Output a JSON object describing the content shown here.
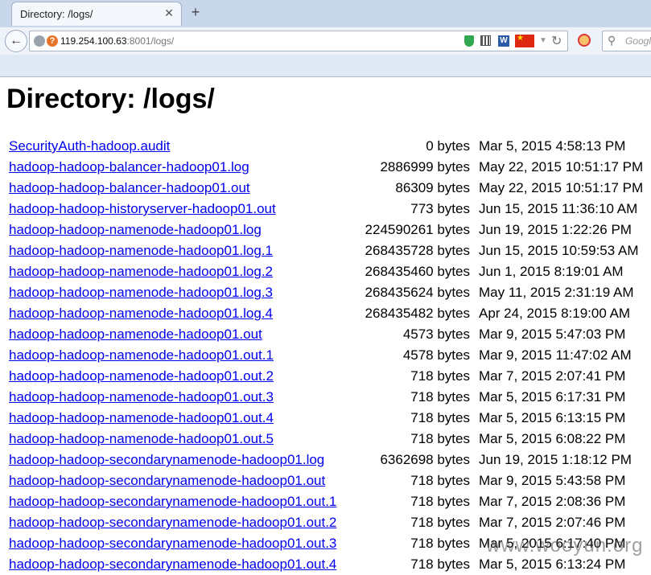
{
  "browser": {
    "tab_title": "Directory: /logs/",
    "tab_close": "✕",
    "new_tab": "+",
    "url_host": "119.254.100.63",
    "url_rest": ":8001/logs/",
    "search_placeholder": "Googl",
    "icons": [
      "back-arrow-icon",
      "globe-icon",
      "warning-icon",
      "shield-icon",
      "qr-code-icon",
      "word-icon",
      "china-flag-icon",
      "dropdown-icon",
      "reload-icon",
      "addon-icon",
      "search-icon"
    ]
  },
  "page": {
    "title": "Directory: /logs/",
    "files": [
      {
        "name": "SecurityAuth-hadoop.audit",
        "size": "0 bytes",
        "date": "Mar 5, 2015 4:58:13 PM"
      },
      {
        "name": "hadoop-hadoop-balancer-hadoop01.log",
        "size": "2886999 bytes",
        "date": "May 22, 2015 10:51:17 PM"
      },
      {
        "name": "hadoop-hadoop-balancer-hadoop01.out",
        "size": "86309 bytes",
        "date": "May 22, 2015 10:51:17 PM"
      },
      {
        "name": "hadoop-hadoop-historyserver-hadoop01.out",
        "size": "773 bytes",
        "date": "Jun 15, 2015 11:36:10 AM"
      },
      {
        "name": "hadoop-hadoop-namenode-hadoop01.log",
        "size": "224590261 bytes",
        "date": "Jun 19, 2015 1:22:26 PM"
      },
      {
        "name": "hadoop-hadoop-namenode-hadoop01.log.1",
        "size": "268435728 bytes",
        "date": "Jun 15, 2015 10:59:53 AM"
      },
      {
        "name": "hadoop-hadoop-namenode-hadoop01.log.2",
        "size": "268435460 bytes",
        "date": "Jun 1, 2015 8:19:01 AM"
      },
      {
        "name": "hadoop-hadoop-namenode-hadoop01.log.3",
        "size": "268435624 bytes",
        "date": "May 11, 2015 2:31:19 AM"
      },
      {
        "name": "hadoop-hadoop-namenode-hadoop01.log.4",
        "size": "268435482 bytes",
        "date": "Apr 24, 2015 8:19:00 AM"
      },
      {
        "name": "hadoop-hadoop-namenode-hadoop01.out",
        "size": "4573 bytes",
        "date": "Mar 9, 2015 5:47:03 PM"
      },
      {
        "name": "hadoop-hadoop-namenode-hadoop01.out.1",
        "size": "4578 bytes",
        "date": "Mar 9, 2015 11:47:02 AM"
      },
      {
        "name": "hadoop-hadoop-namenode-hadoop01.out.2",
        "size": "718 bytes",
        "date": "Mar 7, 2015 2:07:41 PM"
      },
      {
        "name": "hadoop-hadoop-namenode-hadoop01.out.3",
        "size": "718 bytes",
        "date": "Mar 5, 2015 6:17:31 PM"
      },
      {
        "name": "hadoop-hadoop-namenode-hadoop01.out.4",
        "size": "718 bytes",
        "date": "Mar 5, 2015 6:13:15 PM"
      },
      {
        "name": "hadoop-hadoop-namenode-hadoop01.out.5",
        "size": "718 bytes",
        "date": "Mar 5, 2015 6:08:22 PM"
      },
      {
        "name": "hadoop-hadoop-secondarynamenode-hadoop01.log",
        "size": "6362698 bytes",
        "date": "Jun 19, 2015 1:18:12 PM"
      },
      {
        "name": "hadoop-hadoop-secondarynamenode-hadoop01.out",
        "size": "718 bytes",
        "date": "Mar 9, 2015 5:43:58 PM"
      },
      {
        "name": "hadoop-hadoop-secondarynamenode-hadoop01.out.1",
        "size": "718 bytes",
        "date": "Mar 7, 2015 2:08:36 PM"
      },
      {
        "name": "hadoop-hadoop-secondarynamenode-hadoop01.out.2",
        "size": "718 bytes",
        "date": "Mar 7, 2015 2:07:46 PM"
      },
      {
        "name": "hadoop-hadoop-secondarynamenode-hadoop01.out.3",
        "size": "718 bytes",
        "date": "Mar 5, 2015 6:17:40 PM"
      },
      {
        "name": "hadoop-hadoop-secondarynamenode-hadoop01.out.4",
        "size": "718 bytes",
        "date": "Mar 5, 2015 6:13:24 PM"
      }
    ]
  },
  "watermark": "www.wooyun.org"
}
